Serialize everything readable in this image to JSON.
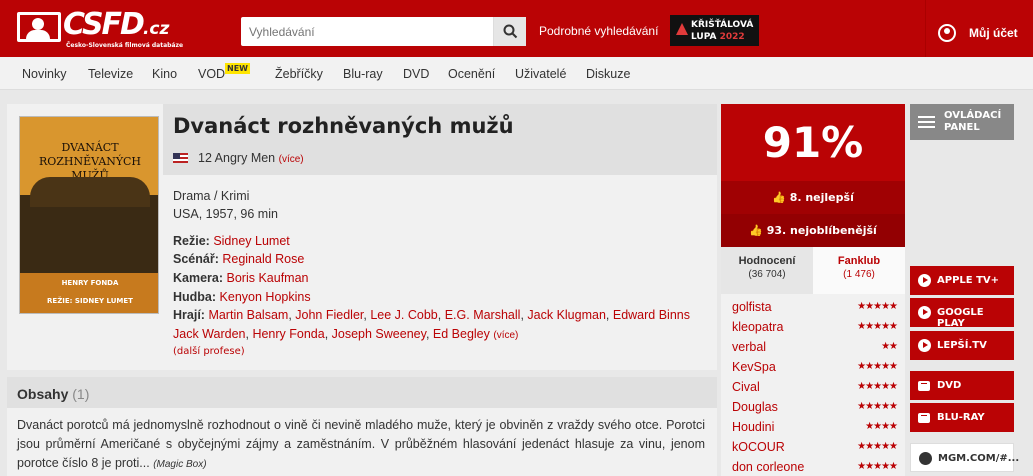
{
  "header": {
    "logo_word": "CSFD",
    "logo_tld": ".cz",
    "logo_subtitle": "Česko-Slovenská filmová databáze",
    "search_placeholder": "Vyhledávání",
    "advanced_search": "Podrobné vyhledávání",
    "award_line1": "KŘIŠŤÁLOVÁ",
    "award_line2": "LUPA",
    "award_year": "2022",
    "account_label": "Můj účet"
  },
  "nav": {
    "items": [
      "Novinky",
      "Televize",
      "Kino",
      "VOD",
      "Žebříčky",
      "Blu-ray",
      "DVD",
      "Ocenění",
      "Uživatelé",
      "Diskuze"
    ],
    "vod_badge": "NEW"
  },
  "film": {
    "title": "Dvanáct rozhněvaných mužů",
    "original_title": "12 Angry Men",
    "original_more": "(více)",
    "genres": "Drama / Krimi",
    "origin": "USA, 1957, 96 min",
    "director_label": "Režie:",
    "director": "Sidney Lumet",
    "writer_label": "Scénář:",
    "writer": "Reginald Rose",
    "camera_label": "Kamera:",
    "camera": "Boris Kaufman",
    "music_label": "Hudba:",
    "music": "Kenyon Hopkins",
    "cast_label": "Hrají:",
    "cast_line1": [
      "Martin Balsam",
      "John Fiedler",
      "Lee J. Cobb",
      "E.G. Marshall",
      "Jack Klugman",
      "Edward Binns"
    ],
    "cast_line2": [
      "Jack Warden",
      "Henry Fonda",
      "Joseph Sweeney",
      "Ed Begley"
    ],
    "cast_more": "(více)",
    "more_professions": "(další profese)",
    "poster": {
      "title_line1": "DVANÁCT",
      "title_line2": "ROZHNĚVANÝCH",
      "title_line3": "MUŽŮ",
      "star": "HENRY FONDA",
      "director_credit": "REŽIE: SIDNEY LUMET"
    }
  },
  "plot": {
    "heading": "Obsahy",
    "count": "(1)",
    "text": "Dvanáct porotců má jednomyslně rozhodnout o vině či nevině mladého muže, který je obviněn z vraždy svého otce. Porotci jsou průměrní Američané s obyčejnými zájmy a zaměstnáním. V průběžném hlasování jedenáct hlasuje za vinu, jenom porotce číslo 8 je proti...",
    "source": "(Magic Box)"
  },
  "rating": {
    "score": "91%",
    "best": "8. nejlepší",
    "disliked": "93. nejoblíbenější",
    "tab_ratings_label": "Hodnocení",
    "tab_ratings_count": "(36 704)",
    "tab_fanclub_label": "Fanklub",
    "tab_fanclub_count": "(1 476)",
    "users": [
      {
        "name": "golfista",
        "stars": 5
      },
      {
        "name": "kleopatra",
        "stars": 5
      },
      {
        "name": "verbal",
        "stars": 2
      },
      {
        "name": "KevSpa",
        "stars": 5
      },
      {
        "name": "Cival",
        "stars": 5
      },
      {
        "name": "Douglas",
        "stars": 5
      },
      {
        "name": "Houdini",
        "stars": 4
      },
      {
        "name": "kOCOUR",
        "stars": 5
      },
      {
        "name": "don corleone",
        "stars": 5
      }
    ]
  },
  "side": {
    "control_panel": "OVLÁDACÍ PANEL",
    "vod_links": [
      "APPLE TV+",
      "GOOGLE PLAY",
      "LEPŠÍ.TV"
    ],
    "shop_links": [
      "DVD",
      "BLU-RAY"
    ],
    "partner_link": "MGM.COM/#..."
  },
  "colors": {
    "brand": "#ba0305",
    "dark_brand": "#930002",
    "nav_bg": "#f2f2f2",
    "page_bg": "#e8e8e8"
  }
}
